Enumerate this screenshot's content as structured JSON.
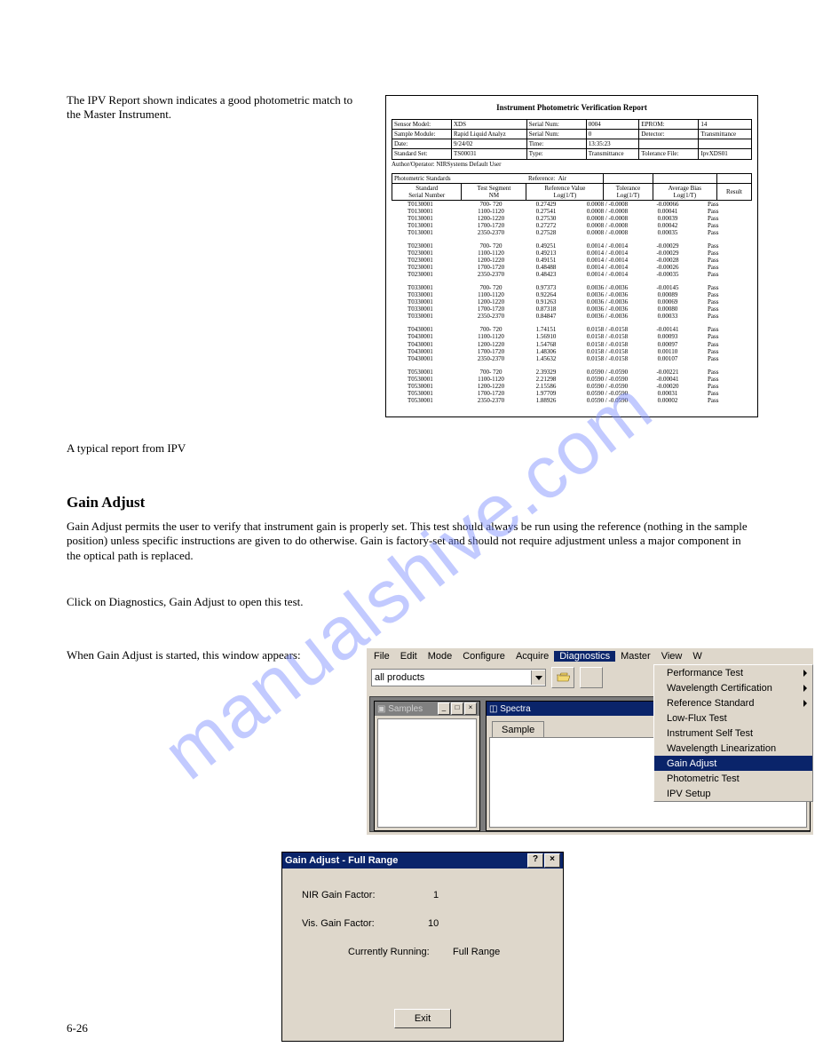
{
  "watermark": "manualshive.com",
  "page_text": {
    "ipv_intro": "The IPV Report shown indicates a good photometric match to the Master Instrument.",
    "caption": "A typical report from IPV",
    "gain_heading": "Gain Adjust",
    "gain_para1": "Gain Adjust permits the user to verify that instrument gain is properly set. This test should always be run using the reference (nothing in the sample position) unless specific instructions are given to do otherwise. Gain is factory-set and should not require adjustment unless a major component in the optical path is replaced.",
    "gain_para2": "Click on Diagnostics, Gain Adjust to open this test.",
    "gain_para3": "When Gain Adjust is started, this window appears:",
    "page_no": "6-26"
  },
  "report": {
    "title": "Instrument Photometric Verification Report",
    "info": [
      [
        "Sensor Model:",
        "XDS",
        "Serial Num:",
        "0004",
        "EPROM:",
        "14"
      ],
      [
        "Sample Module:",
        "Rapid Liquid Analyz",
        "Serial Num:",
        "0",
        "Detector:",
        "Transmittance"
      ],
      [
        "Date:",
        "9/24/02",
        "Time:",
        "13:35:23",
        "",
        ""
      ],
      [
        "Standard Set:",
        "TS00031",
        "Type:",
        "Transmittance",
        "Tolerance File:",
        "IpvXDS01"
      ]
    ],
    "author_label": "Author/Operator:",
    "author_value": "NIRSystems Default User",
    "standards_label": "Photometric Standards",
    "reference_label": "Reference:",
    "reference_value": "Air",
    "headers": {
      "c1a": "Standard",
      "c1b": "Serial Number",
      "c2a": "Test Segment",
      "c2b": "NM",
      "c3a": "Reference Value",
      "c3b": "Log(1/T)",
      "c4a": "Tolerance",
      "c4b": "Log(1/T)",
      "c5a": "Average Bias",
      "c5b": "Log(1/T)",
      "c6": "Result"
    },
    "rows": [
      [
        [
          "T0130001",
          "700- 720",
          "0.27429",
          "0.0008 / -0.0008",
          "-0.00066",
          "Pass"
        ],
        [
          "T0130001",
          "1100-1120",
          "0.27541",
          "0.0008 / -0.0008",
          "0.00041",
          "Pass"
        ],
        [
          "T0130001",
          "1200-1220",
          "0.27530",
          "0.0008 / -0.0008",
          "0.00039",
          "Pass"
        ],
        [
          "T0130001",
          "1700-1720",
          "0.27272",
          "0.0008 / -0.0008",
          "0.00042",
          "Pass"
        ],
        [
          "T0130001",
          "2350-2370",
          "0.27528",
          "0.0008 / -0.0008",
          "0.00035",
          "Pass"
        ]
      ],
      [
        [
          "T0230001",
          "700- 720",
          "0.49251",
          "0.0014 / -0.0014",
          "-0.00029",
          "Pass"
        ],
        [
          "T0230001",
          "1100-1120",
          "0.49213",
          "0.0014 / -0.0014",
          "-0.00029",
          "Pass"
        ],
        [
          "T0230001",
          "1200-1220",
          "0.49151",
          "0.0014 / -0.0014",
          "-0.00028",
          "Pass"
        ],
        [
          "T0230001",
          "1700-1720",
          "0.48488",
          "0.0014 / -0.0014",
          "-0.00026",
          "Pass"
        ],
        [
          "T0230001",
          "2350-2370",
          "0.48423",
          "0.0014 / -0.0014",
          "-0.00035",
          "Pass"
        ]
      ],
      [
        [
          "T0330001",
          "700- 720",
          "0.97373",
          "0.0036 / -0.0036",
          "-0.00145",
          "Pass"
        ],
        [
          "T0330001",
          "1100-1120",
          "0.92264",
          "0.0036 / -0.0036",
          "0.00089",
          "Pass"
        ],
        [
          "T0330001",
          "1200-1220",
          "0.91263",
          "0.0036 / -0.0036",
          "0.00069",
          "Pass"
        ],
        [
          "T0330001",
          "1700-1720",
          "0.87318",
          "0.0036 / -0.0036",
          "0.00080",
          "Pass"
        ],
        [
          "T0330001",
          "2350-2370",
          "0.84847",
          "0.0036 / -0.0036",
          "0.00033",
          "Pass"
        ]
      ],
      [
        [
          "T0430001",
          "700- 720",
          "1.74151",
          "0.0158 / -0.0158",
          "-0.00141",
          "Pass"
        ],
        [
          "T0430001",
          "1100-1120",
          "1.56910",
          "0.0158 / -0.0158",
          "0.00093",
          "Pass"
        ],
        [
          "T0430001",
          "1200-1220",
          "1.54768",
          "0.0158 / -0.0158",
          "0.00097",
          "Pass"
        ],
        [
          "T0430001",
          "1700-1720",
          "1.48306",
          "0.0158 / -0.0158",
          "0.00110",
          "Pass"
        ],
        [
          "T0430001",
          "2350-2370",
          "1.45632",
          "0.0158 / -0.0158",
          "0.00107",
          "Pass"
        ]
      ],
      [
        [
          "T0530001",
          "700- 720",
          "2.39329",
          "0.0590 / -0.0590",
          "-0.00221",
          "Pass"
        ],
        [
          "T0530001",
          "1100-1120",
          "2.21298",
          "0.0590 / -0.0590",
          "-0.00041",
          "Pass"
        ],
        [
          "T0530001",
          "1200-1220",
          "2.15586",
          "0.0590 / -0.0590",
          "-0.00020",
          "Pass"
        ],
        [
          "T0530001",
          "1700-1720",
          "1.97709",
          "0.0590 / -0.0590",
          "0.00031",
          "Pass"
        ],
        [
          "T0530001",
          "2350-2370",
          "1.88926",
          "0.0590 / -0.0590",
          "0.00002",
          "Pass"
        ]
      ]
    ]
  },
  "app": {
    "menubar": [
      "File",
      "Edit",
      "Mode",
      "Configure",
      "Acquire",
      "Diagnostics",
      "Master",
      "View",
      "W"
    ],
    "active_menu_index": 5,
    "combo": "all products",
    "samples_title": "Samples",
    "spectra_title": "Spectra",
    "tab": "Sample",
    "menu_items": [
      {
        "label": "Performance Test",
        "sub": true
      },
      {
        "label": "Wavelength Certification",
        "sub": true
      },
      {
        "label": "Reference Standard",
        "sub": true
      },
      {
        "label": "Low-Flux Test",
        "sub": false
      },
      {
        "label": "Instrument Self Test",
        "sub": false
      },
      {
        "label": "Wavelength Linearization",
        "sub": false
      },
      {
        "label": "Gain Adjust",
        "sub": false,
        "on": true
      },
      {
        "label": "Photometric Test",
        "sub": false
      },
      {
        "label": "IPV Setup",
        "sub": false
      }
    ]
  },
  "dlg": {
    "title": "Gain Adjust - Full Range",
    "nir_label": "NIR Gain Factor:",
    "nir_value": "1",
    "vis_label": "Vis. Gain Factor:",
    "vis_value": "10",
    "running_label": "Currently Running:",
    "running_value": "Full Range",
    "exit": "Exit"
  }
}
